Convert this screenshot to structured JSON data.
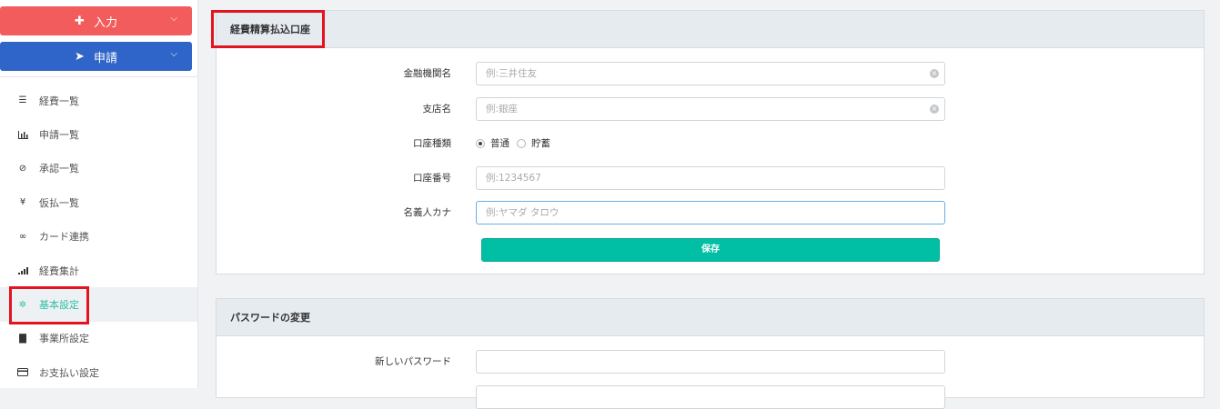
{
  "sidebar": {
    "input_button": "入力",
    "apply_button": "申請",
    "items": [
      {
        "label": "経費一覧",
        "icon": "list-icon"
      },
      {
        "label": "申請一覧",
        "icon": "bar-chart-icon"
      },
      {
        "label": "承認一覧",
        "icon": "check-circle-icon"
      },
      {
        "label": "仮払一覧",
        "icon": "yen-icon"
      },
      {
        "label": "カード連携",
        "icon": "link-icon"
      },
      {
        "label": "経費集計",
        "icon": "signal-icon"
      },
      {
        "label": "基本設定",
        "icon": "gear-icon",
        "active": true
      },
      {
        "label": "事業所設定",
        "icon": "building-icon"
      },
      {
        "label": "お支払い設定",
        "icon": "credit-card-icon"
      }
    ]
  },
  "bank_panel": {
    "title": "経費精算払込口座",
    "bank_name": {
      "label": "金融機関名",
      "placeholder": "例:三井住友"
    },
    "branch": {
      "label": "支店名",
      "placeholder": "例:銀座"
    },
    "account_type": {
      "label": "口座種類",
      "options": [
        "普通",
        "貯蓄"
      ],
      "selected": "普通"
    },
    "account_number": {
      "label": "口座番号",
      "placeholder": "例:1234567"
    },
    "holder_kana": {
      "label": "名義人カナ",
      "placeholder": "例:ヤマダ タロウ"
    },
    "save_label": "保存"
  },
  "password_panel": {
    "title": "パスワードの変更",
    "new_password": {
      "label": "新しいパスワード",
      "value": ""
    }
  },
  "colors": {
    "input_button": "#f25c5c",
    "apply_button": "#2f64c9",
    "save_button": "#00bfa5",
    "highlight": "#e3141f",
    "active_nav": "#2fbfa5"
  }
}
